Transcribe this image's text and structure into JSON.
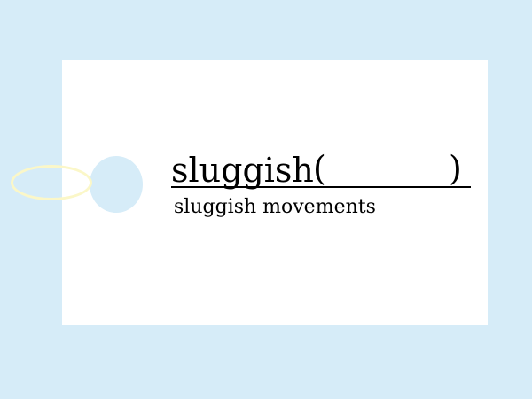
{
  "colors": {
    "background": "#d6ecf8",
    "card": "#ffffff",
    "hole": "#d6ecf8",
    "ring": "#fbf7c8",
    "text": "#000000"
  },
  "card": {
    "word": "sluggish",
    "paren_open": "(",
    "paren_close": ")",
    "answer": "",
    "example": "sluggish movements"
  }
}
